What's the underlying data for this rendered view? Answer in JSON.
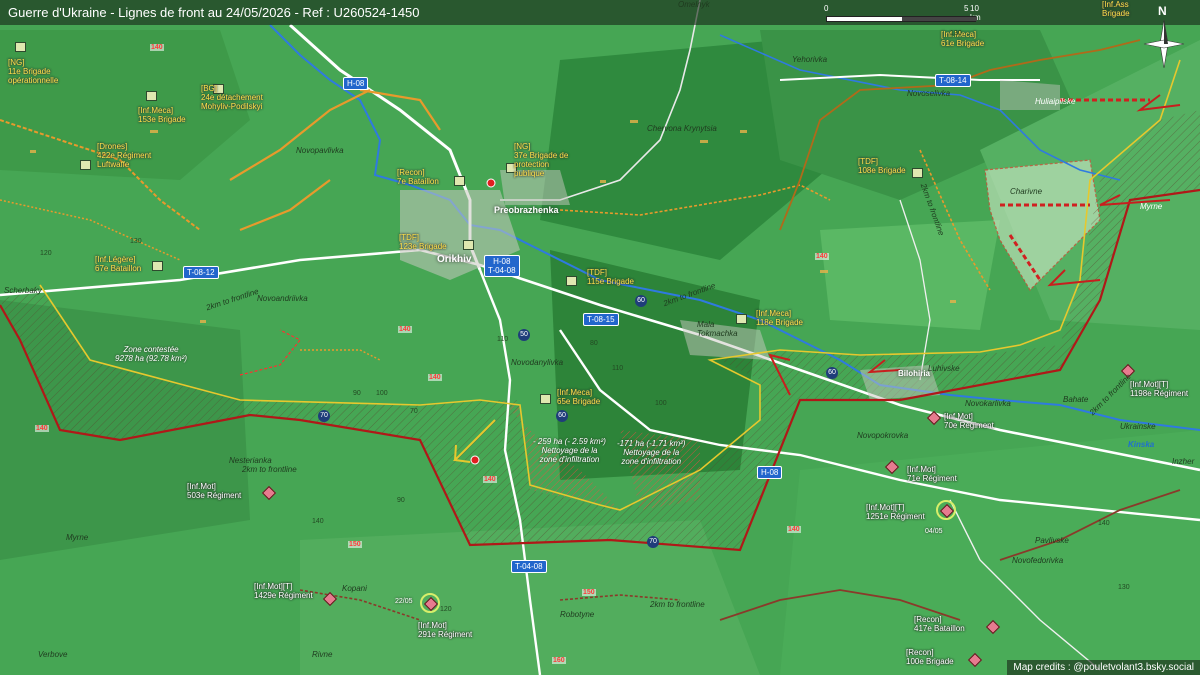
{
  "title": "Guerre d'Ukraine - Lignes de front au 24/05/2026 - Ref : U260524-1450",
  "credits": "Map credits : @pouletvolant3.bsky.social",
  "scale": {
    "zero": "0",
    "mid": "5",
    "end": "10 km"
  },
  "north_label": "N",
  "colors": {
    "front_line_ru": "#b01818",
    "contested_line": "#e6c82e",
    "infiltration": "#ff2a2a",
    "river": "#2f7ae0",
    "road": "#ffffff"
  },
  "towns": {
    "orikhiv": "Orikhiv",
    "preobrazhenka": "Preobrazhenka",
    "bilohiria": "Bilohiria"
  },
  "places": {
    "omelnyk": "Omelnyk",
    "yehorivka": "Yehorivka",
    "novoselivka": "Novoselivka",
    "huliaipilske": "Huliaipilske",
    "chervona_krynytsia": "Chervona Krynytsia",
    "novopavlivka": "Novopavlivka",
    "charivne": "Charivne",
    "myrne_e": "Myrne",
    "scherbaky": "Scherbaky",
    "novoandriivka": "Novoandriivka",
    "mala_tokmachka": "Mala\nTokmachka",
    "luhivske": "Luhivske",
    "novodanylivka": "Novodanylivka",
    "novokarlivka": "Novokarlivka",
    "bahate": "Bahate",
    "ukrainske": "Ukrainske",
    "novopokrovka": "Novopokrovka",
    "inzhenerne": "Inzher",
    "nesterianka": "Nesterianka",
    "myrne_w": "Myrne",
    "pavlivske": "Pavlivske",
    "novofedorivka": "Novofedorivka",
    "kopani": "Kopani",
    "robotyne": "Robotyne",
    "verbove": "Verbove",
    "rivne": "Rivne",
    "kinska": "Kinska"
  },
  "roads": {
    "h08_north": "H-08",
    "h08_t0408": "H-08\nT-04-08",
    "t0812": "T-08-12",
    "t0815": "T-08-15",
    "t0814": "T-08-14",
    "h08_east": "H-08",
    "t0408_south": "T-04-08"
  },
  "ring_roads": [
    "60",
    "50",
    "60",
    "60",
    "70",
    "70"
  ],
  "ukr_units": [
    {
      "id": "ng11",
      "text": "[NG]\n11e Brigade\nopérationnelle"
    },
    {
      "id": "bg24",
      "text": "[BG]\n24e détachement\nMohyliv-Podilskyi"
    },
    {
      "id": "infmeca153",
      "text": "[Inf.Meca]\n153e Brigade"
    },
    {
      "id": "drones422",
      "text": "[Drones]\n422e Régiment\nLuftwaffe"
    },
    {
      "id": "ng37",
      "text": "[NG]\n37e Brigade de\nprotection\npublique"
    },
    {
      "id": "recon7",
      "text": "[Recon]\n7e Bataillon"
    },
    {
      "id": "tdf123",
      "text": "[TDF]\n123e Brigade"
    },
    {
      "id": "legere67",
      "text": "[Inf.Légère]\n67e Bataillon"
    },
    {
      "id": "tdf115",
      "text": "[TDF]\n115e Brigade"
    },
    {
      "id": "infmeca118",
      "text": "[Inf.Meca]\n118e Brigade"
    },
    {
      "id": "infmeca65",
      "text": "[Inf.Meca]\n65e Brigade"
    },
    {
      "id": "tdf108",
      "text": "[TDF]\n108e Brigade"
    },
    {
      "id": "infmeca61",
      "text": "[Inf.Meca]\n61e Brigade"
    },
    {
      "id": "infassault",
      "text": "[Inf.Ass\nBrigade"
    }
  ],
  "ru_units": [
    {
      "id": "mot1198",
      "text": "[Inf.Mot][T]\n1198e Régiment"
    },
    {
      "id": "mot70",
      "text": "[Inf.Mot]\n70e Régiment"
    },
    {
      "id": "mot71",
      "text": "[Inf.Mot]\n71e Régiment"
    },
    {
      "id": "mot1251",
      "text": "[Inf.Mot][T]\n1251e Régiment"
    },
    {
      "id": "mot503",
      "text": "[Inf.Mot]\n503e Régiment"
    },
    {
      "id": "mot1429",
      "text": "[Inf.Mot][T]\n1429e Régiment"
    },
    {
      "id": "mot291",
      "text": "[Inf.Mot]\n291e Régiment"
    },
    {
      "id": "recon417",
      "text": "[Recon]\n417e Bataillon"
    },
    {
      "id": "recon100",
      "text": "[Recon]\n100e Brigade"
    }
  ],
  "dates": {
    "d2205": "22/05",
    "d0405": "04/05"
  },
  "zones": {
    "contested": "Zone contestée\n9278 ha (92.78 km²)",
    "infil_a": "- 259 ha (- 2.59 km²)\nNettoyage de la\nzone d'infiltration",
    "infil_b": "-171 ha (-1.71 km²)\nNettoyage de la\nzone d'infiltration"
  },
  "distances": {
    "d1": "2km to frontline",
    "d2": "2km to frontline",
    "d3": "2km to frontline",
    "d4": "2km to frontline",
    "d5": "2km to frontline",
    "d6": "2km to frontline"
  },
  "altitudes": [
    "140",
    "130",
    "120",
    "110",
    "100",
    "90",
    "80",
    "70",
    "140",
    "140",
    "140",
    "140",
    "140",
    "150",
    "150",
    "160",
    "140",
    "110",
    "100",
    "90",
    "140",
    "140",
    "130",
    "120",
    "130"
  ]
}
